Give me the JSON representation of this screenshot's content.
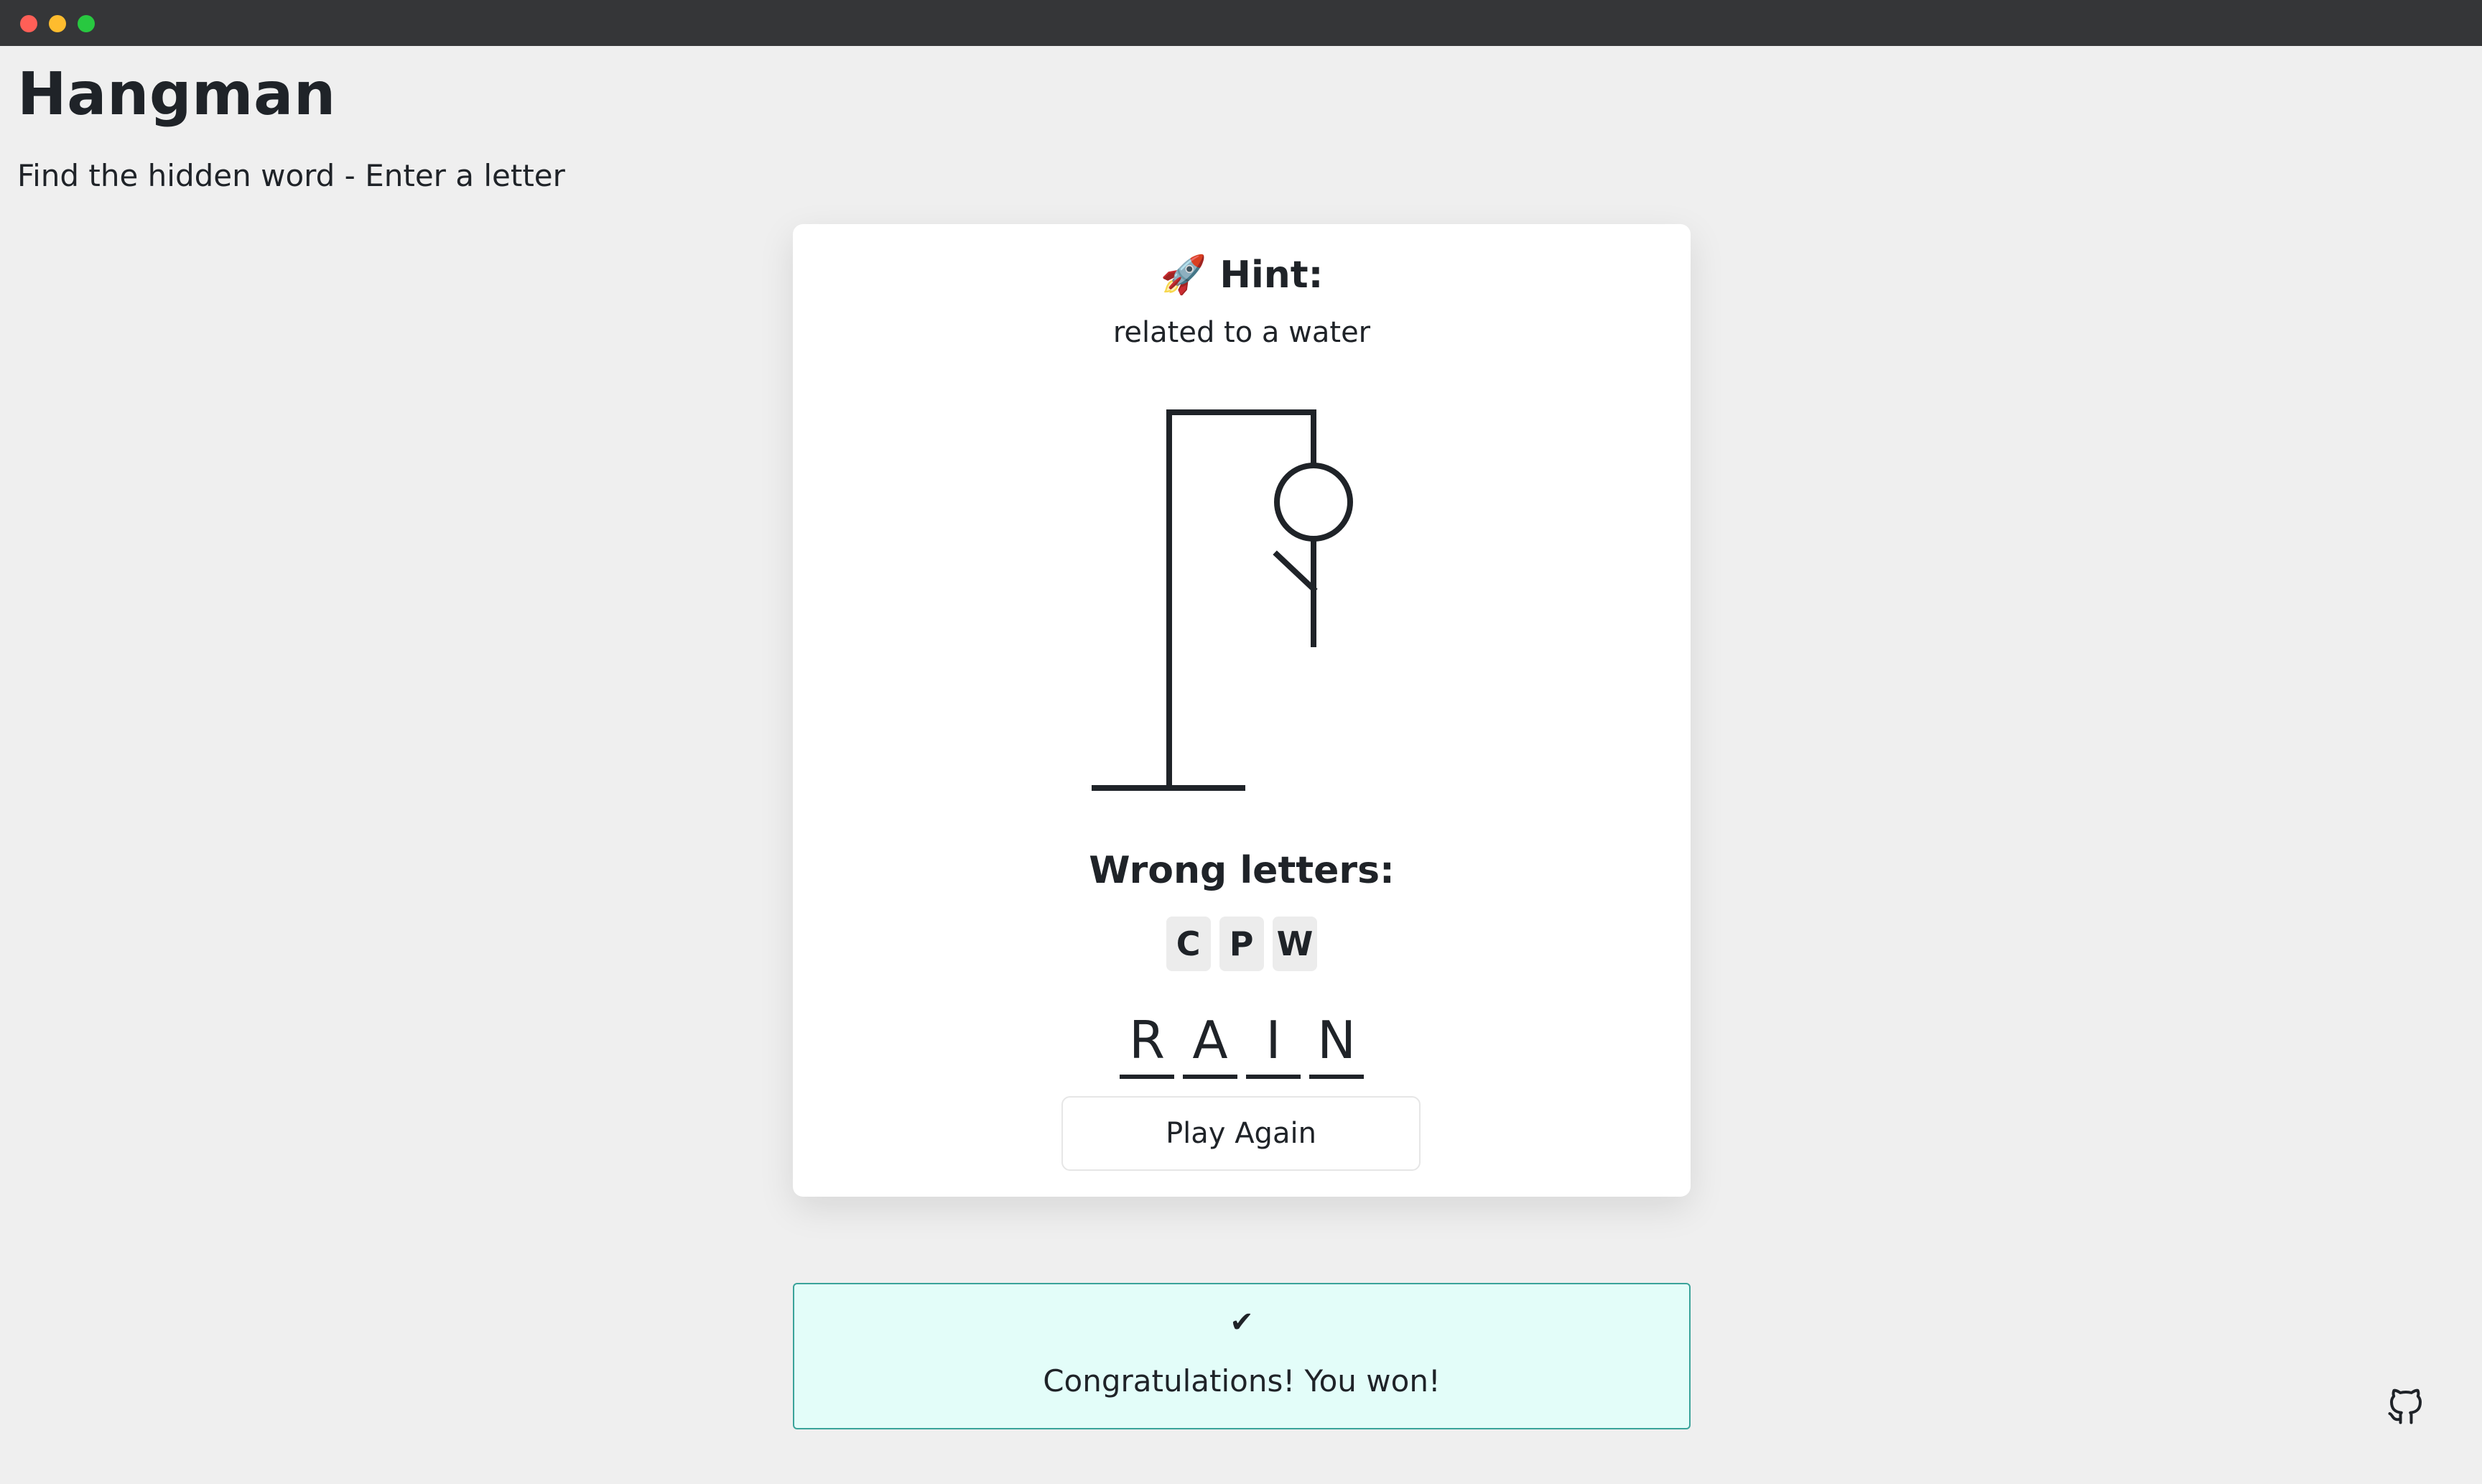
{
  "window": {
    "controls": [
      "close",
      "minimize",
      "zoom"
    ]
  },
  "header": {
    "title": "Hangman",
    "subtitle": "Find the hidden word - Enter a letter"
  },
  "hint": {
    "icon": "🚀",
    "label": "Hint:",
    "text": "related to a water"
  },
  "figure": {
    "parts_shown": [
      "head",
      "body",
      "left-arm"
    ],
    "stroke_color": "#1f2328"
  },
  "wrong_letters": {
    "label": "Wrong letters:",
    "letters": [
      "C",
      "P",
      "W"
    ]
  },
  "word": {
    "letters": [
      "R",
      "A",
      "I",
      "N"
    ]
  },
  "play_again_label": "Play Again",
  "notification": {
    "icon": "✔",
    "message": "Congratulations! You won!",
    "background": "#e3fdf9",
    "border": "#3aa39a"
  },
  "footer": {
    "icon": "github-icon"
  }
}
